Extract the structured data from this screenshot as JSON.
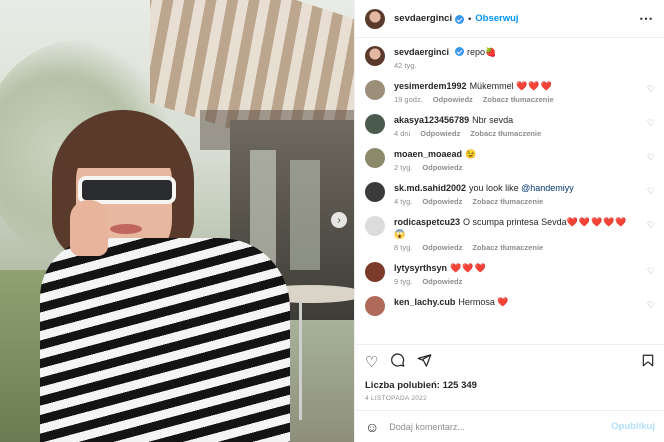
{
  "header": {
    "username": "sevdaerginci",
    "follow_label": "Obserwuj",
    "separator": "•",
    "more_icon": "more-horizontal-icon"
  },
  "caption": {
    "username": "sevdaerginci",
    "text": "repo🍓",
    "time": "42 tyg."
  },
  "comments": [
    {
      "username": "yesimerdem1992",
      "text": "Mükemmel",
      "hearts": "❤️❤️❤️",
      "time": "19 godz.",
      "reply": "Odpowiedz",
      "translate": "Zobacz tłumaczenie",
      "avatar_color": "#9c8f7a"
    },
    {
      "username": "akasya123456789",
      "text": "Nbr sevda",
      "hearts": "",
      "time": "4 dni",
      "reply": "Odpowiedz",
      "translate": "Zobacz tłumaczenie",
      "avatar_color": "#4a5a4d"
    },
    {
      "username": "moaen_moaead",
      "text": "😉",
      "hearts": "",
      "time": "2 tyg.",
      "reply": "Odpowiedz",
      "translate": "",
      "avatar_color": "#8a8a6a"
    },
    {
      "username": "sk.md.sahid2002",
      "text": "you look like",
      "mention": "@handemiyy",
      "hearts": "",
      "time": "4 tyg.",
      "reply": "Odpowiedz",
      "translate": "Zobacz tłumaczenie",
      "avatar_color": "#3b3b3b"
    },
    {
      "username": "rodicaspetcu23",
      "text": "O scumpa printesa Sevda",
      "hearts": "❤️❤️❤️❤️❤️😱",
      "time": "8 tyg.",
      "reply": "Odpowiedz",
      "translate": "Zobacz tłumaczenie",
      "avatar_color": "#dcdcdc"
    },
    {
      "username": "lytysyrthsyn",
      "text": "",
      "hearts": "❤️❤️❤️",
      "time": "9 tyg.",
      "reply": "Odpowiedz",
      "translate": "",
      "avatar_color": "#7a3b2a"
    },
    {
      "username": "ken_lachy.cub",
      "text": "Hermosa",
      "hearts": "❤️",
      "time": "",
      "reply": "",
      "translate": "",
      "avatar_color": "#b06a5a"
    }
  ],
  "actions": {
    "like_icon": "heart-outline-icon",
    "comment_icon": "comment-icon",
    "share_icon": "send-icon",
    "save_icon": "bookmark-icon",
    "likes_label": "Liczba polubień: 125 349",
    "date": "4 LISTOPADA 2022"
  },
  "composer": {
    "placeholder": "Dodaj komentarz...",
    "post_label": "Opublikuj"
  },
  "photo": {
    "next_arrow": "›"
  }
}
